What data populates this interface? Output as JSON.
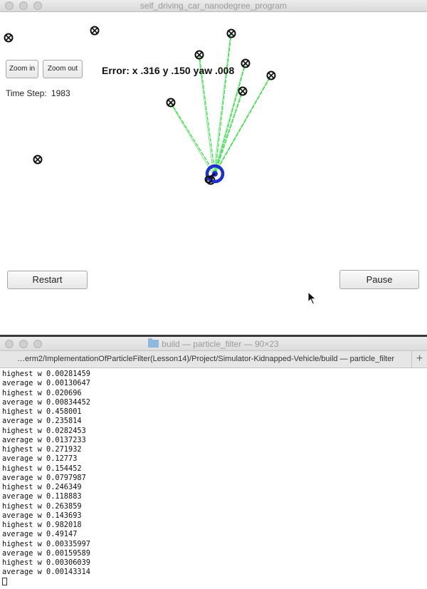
{
  "simulator": {
    "window_title": "self_driving_car_nanodegree_program",
    "zoom_in_label": "Zoom in",
    "zoom_out_label": "Zoom out",
    "time_step_label": "Time Step:",
    "time_step_value": "1983",
    "error": {
      "x": "Error: x .316",
      "y": "y .150",
      "yaw": "yaw .008"
    },
    "restart_label": "Restart",
    "pause_label": "Pause",
    "observation_line_color": "#33dd44",
    "vehicle_color": "#1f2fd0",
    "landmark_count": 10,
    "observation_count": 6
  },
  "terminal": {
    "window_title": "build — particle_filter — 90×23",
    "tab_title": "…erm2/ImplementationOfParticleFilter(Lesson14)/Project/Simulator-Kidnapped-Vehicle/build — particle_filter",
    "new_tab_label": "+",
    "lines": [
      "highest w 0.00281459",
      "average w 0.00130647",
      "highest w 0.020696",
      "average w 0.00834452",
      "highest w 0.458001",
      "average w 0.235814",
      "highest w 0.0282453",
      "average w 0.0137233",
      "highest w 0.271932",
      "average w 0.12773",
      "highest w 0.154452",
      "average w 0.0797987",
      "highest w 0.246349",
      "average w 0.118883",
      "highest w 0.263859",
      "average w 0.143693",
      "highest w 0.982018",
      "average w 0.49147",
      "highest w 0.00335997",
      "average w 0.00159589",
      "highest w 0.00306039",
      "average w 0.00143314"
    ]
  }
}
